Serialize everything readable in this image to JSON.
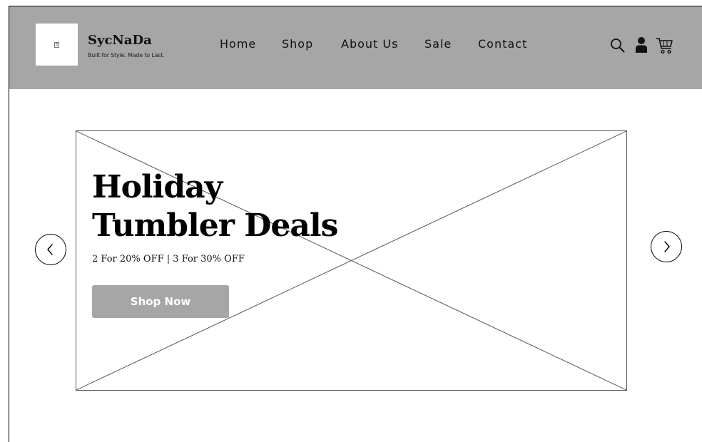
{
  "header": {
    "logo_mark": "B",
    "brand_name": "SycNaDa",
    "tagline": "Built for Style. Made to Last.",
    "nav": [
      "Home",
      "Shop",
      "About Us",
      "Sale",
      "Contact"
    ],
    "icons": [
      "search-icon",
      "user-icon",
      "cart-icon"
    ]
  },
  "hero": {
    "headline_line1": "Holiday",
    "headline_line2": "Tumbler Deals",
    "subline": "2 For 20% OFF | 3 For 30% OFF",
    "cta_label": "Shop Now",
    "prev_icon": "chevron-left-icon",
    "next_icon": "chevron-right-icon"
  },
  "colors": {
    "header_bg": "#a6a6a6",
    "button_bg": "#a6a6a6",
    "text": "#000000"
  }
}
